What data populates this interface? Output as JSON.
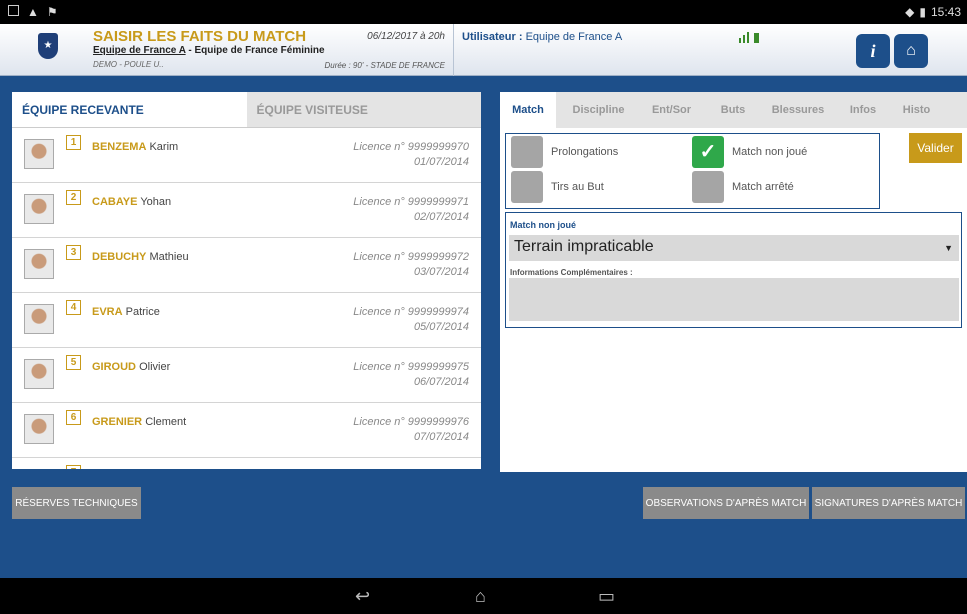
{
  "statusbar": {
    "time": "15:43"
  },
  "header": {
    "title": "SAISIR LES FAITS DU MATCH",
    "team_home": "Equipe de France A",
    "team_sep": " - ",
    "team_away": "Equipe de France Féminine",
    "demo": "DEMO - POULE U..",
    "date": "06/12/2017 à 20h",
    "duree": "Durée : 90' - STADE DE FRANCE",
    "user_label": "Utilisateur :",
    "user_value": "Equipe de France A",
    "info_label": "i"
  },
  "left": {
    "tab_home": "ÉQUIPE RECEVANTE",
    "tab_away": "ÉQUIPE VISITEUSE",
    "players": [
      {
        "num": "1",
        "last": "BENZEMA",
        "first": "Karim",
        "licence": "Licence n° 9999999970",
        "date": "01/07/2014"
      },
      {
        "num": "2",
        "last": "CABAYE",
        "first": "Yohan",
        "licence": "Licence n° 9999999971",
        "date": "02/07/2014"
      },
      {
        "num": "3",
        "last": "DEBUCHY",
        "first": "Mathieu",
        "licence": "Licence n° 9999999972",
        "date": "03/07/2014"
      },
      {
        "num": "4",
        "last": "EVRA",
        "first": "Patrice",
        "licence": "Licence n° 9999999974",
        "date": "05/07/2014"
      },
      {
        "num": "5",
        "last": "GIROUD",
        "first": "Olivier",
        "licence": "Licence n° 9999999975",
        "date": "06/07/2014"
      },
      {
        "num": "6",
        "last": "GRENIER",
        "first": "Clement",
        "licence": "Licence n° 9999999976",
        "date": "07/07/2014"
      },
      {
        "num": "7",
        "last": "",
        "first": "",
        "licence": "",
        "date": ""
      }
    ]
  },
  "right": {
    "tabs": [
      "Match",
      "Discipline",
      "Ent/Sor",
      "Buts",
      "Blessures",
      "Infos",
      "Histo"
    ],
    "prolongations": "Prolongations",
    "tirs_au_but": "Tirs au But",
    "match_non_joue": "Match non joué",
    "match_arrete": "Match arrêté",
    "valider": "Valider",
    "mnj_title": "Match non joué",
    "select_value": "Terrain impraticable",
    "info_label": "Informations Complémentaires :"
  },
  "buttons": {
    "reserves": "RÉSERVES TECHNIQUES",
    "observations": "OBSERVATIONS D'APRÈS MATCH",
    "signatures": "SIGNATURES D'APRÈS MATCH"
  },
  "colors": {
    "brand_blue": "#1d4f8a",
    "gold": "#c89a1a",
    "check_green": "#2fa84a"
  }
}
